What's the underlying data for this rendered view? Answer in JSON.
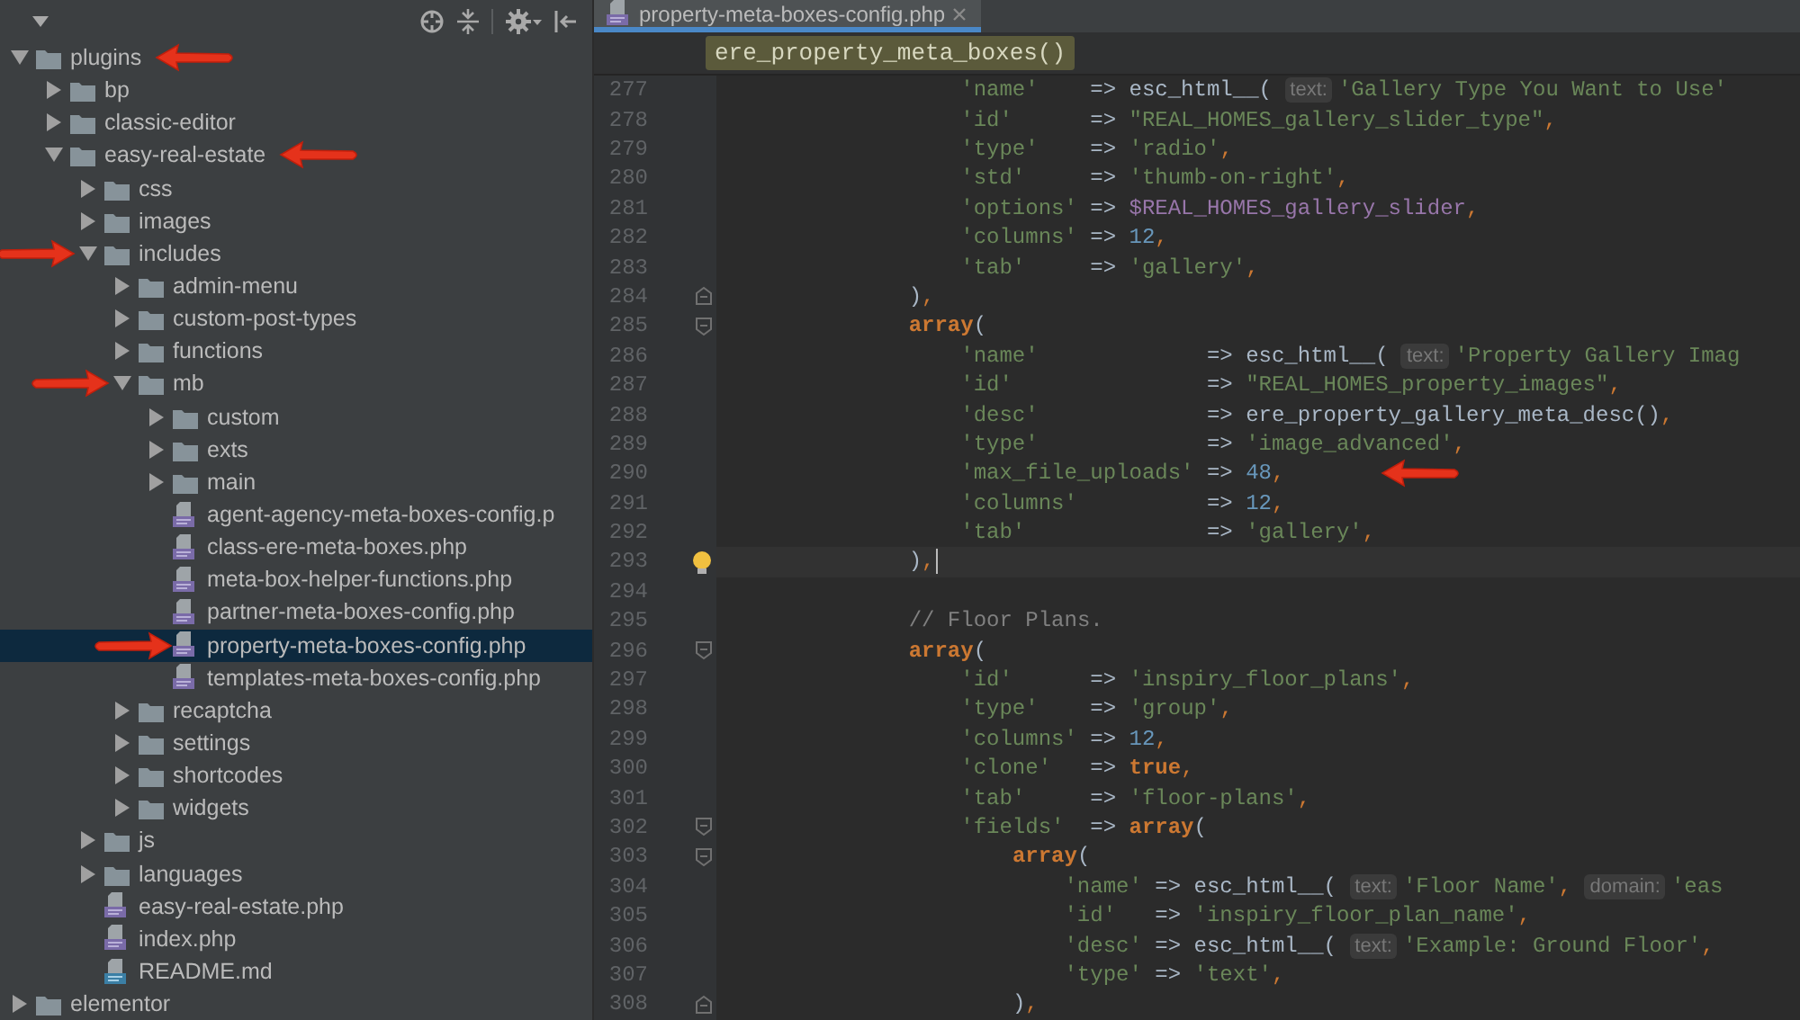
{
  "project_panel": {
    "tree": [
      {
        "name": "plugins",
        "kind": "folder",
        "expanded": true,
        "selected": false,
        "arrow_after": true,
        "children": [
          {
            "name": "bp",
            "kind": "folder",
            "expanded": false,
            "selected": false
          },
          {
            "name": "classic-editor",
            "kind": "folder",
            "expanded": false,
            "selected": false
          },
          {
            "name": "easy-real-estate",
            "kind": "folder",
            "expanded": true,
            "selected": false,
            "arrow_after": true,
            "children": [
              {
                "name": "css",
                "kind": "folder",
                "expanded": false,
                "selected": false
              },
              {
                "name": "images",
                "kind": "folder",
                "expanded": false,
                "selected": false
              },
              {
                "name": "includes",
                "kind": "folder",
                "expanded": true,
                "selected": false,
                "arrow_before": true,
                "children": [
                  {
                    "name": "admin-menu",
                    "kind": "folder",
                    "expanded": false,
                    "selected": false
                  },
                  {
                    "name": "custom-post-types",
                    "kind": "folder",
                    "expanded": false,
                    "selected": false
                  },
                  {
                    "name": "functions",
                    "kind": "folder",
                    "expanded": false,
                    "selected": false
                  },
                  {
                    "name": "mb",
                    "kind": "folder",
                    "expanded": true,
                    "selected": false,
                    "arrow_before": true,
                    "children": [
                      {
                        "name": "custom",
                        "kind": "folder",
                        "expanded": false,
                        "selected": false
                      },
                      {
                        "name": "exts",
                        "kind": "folder",
                        "expanded": false,
                        "selected": false
                      },
                      {
                        "name": "main",
                        "kind": "folder",
                        "expanded": false,
                        "selected": false
                      },
                      {
                        "name": "agent-agency-meta-boxes-config.p",
                        "kind": "php",
                        "selected": false
                      },
                      {
                        "name": "class-ere-meta-boxes.php",
                        "kind": "php",
                        "selected": false
                      },
                      {
                        "name": "meta-box-helper-functions.php",
                        "kind": "php",
                        "selected": false
                      },
                      {
                        "name": "partner-meta-boxes-config.php",
                        "kind": "php",
                        "selected": false
                      },
                      {
                        "name": "property-meta-boxes-config.php",
                        "kind": "php",
                        "selected": true,
                        "arrow_before": true
                      },
                      {
                        "name": "templates-meta-boxes-config.php",
                        "kind": "php",
                        "selected": false
                      }
                    ]
                  },
                  {
                    "name": "recaptcha",
                    "kind": "folder",
                    "expanded": false,
                    "selected": false
                  },
                  {
                    "name": "settings",
                    "kind": "folder",
                    "expanded": false,
                    "selected": false
                  },
                  {
                    "name": "shortcodes",
                    "kind": "folder",
                    "expanded": false,
                    "selected": false
                  },
                  {
                    "name": "widgets",
                    "kind": "folder",
                    "expanded": false,
                    "selected": false
                  }
                ]
              },
              {
                "name": "js",
                "kind": "folder",
                "expanded": false,
                "selected": false
              },
              {
                "name": "languages",
                "kind": "folder",
                "expanded": false,
                "selected": false
              },
              {
                "name": "easy-real-estate.php",
                "kind": "php",
                "selected": false
              },
              {
                "name": "index.php",
                "kind": "php",
                "selected": false
              },
              {
                "name": "README.md",
                "kind": "md",
                "selected": false
              }
            ]
          }
        ]
      },
      {
        "name": "elementor",
        "kind": "folder",
        "expanded": false,
        "selected": false
      }
    ]
  },
  "editor": {
    "tab": {
      "title": "property-meta-boxes-config.php",
      "selected": true
    },
    "breadcrumb": "ere_property_meta_boxes()",
    "lines": [
      {
        "number": "277",
        "segments": [
          {
            "kind": "str",
            "text": "                  'name'"
          },
          {
            "kind": "plain",
            "text": "    => esc_html__( "
          },
          {
            "kind": "hint",
            "text": "text:"
          },
          {
            "kind": "str",
            "text": "'Gallery Type You Want to Use'"
          }
        ]
      },
      {
        "number": "278",
        "segments": [
          {
            "kind": "str",
            "text": "                  'id'"
          },
          {
            "kind": "plain",
            "text": "      => "
          },
          {
            "kind": "str",
            "text": "\"REAL_HOMES_gallery_slider_type\""
          },
          {
            "kind": "punct",
            "text": ","
          }
        ]
      },
      {
        "number": "279",
        "segments": [
          {
            "kind": "str",
            "text": "                  'type'"
          },
          {
            "kind": "plain",
            "text": "    => "
          },
          {
            "kind": "str",
            "text": "'radio'"
          },
          {
            "kind": "punct",
            "text": ","
          }
        ]
      },
      {
        "number": "280",
        "segments": [
          {
            "kind": "str",
            "text": "                  'std'"
          },
          {
            "kind": "plain",
            "text": "     => "
          },
          {
            "kind": "str",
            "text": "'thumb-on-right'"
          },
          {
            "kind": "punct",
            "text": ","
          }
        ]
      },
      {
        "number": "281",
        "segments": [
          {
            "kind": "str",
            "text": "                  'options'"
          },
          {
            "kind": "plain",
            "text": " => "
          },
          {
            "kind": "var",
            "text": "$REAL_HOMES_gallery_slider"
          },
          {
            "kind": "punct",
            "text": ","
          }
        ]
      },
      {
        "number": "282",
        "segments": [
          {
            "kind": "str",
            "text": "                  'columns'"
          },
          {
            "kind": "plain",
            "text": " => "
          },
          {
            "kind": "num",
            "text": "12"
          },
          {
            "kind": "punct",
            "text": ","
          }
        ]
      },
      {
        "number": "283",
        "segments": [
          {
            "kind": "str",
            "text": "                  'tab'"
          },
          {
            "kind": "plain",
            "text": "     => "
          },
          {
            "kind": "str",
            "text": "'gallery'"
          },
          {
            "kind": "punct",
            "text": ","
          }
        ]
      },
      {
        "number": "284",
        "fold_end": true,
        "segments": [
          {
            "kind": "plain",
            "text": "              )"
          },
          {
            "kind": "punct",
            "text": ","
          }
        ]
      },
      {
        "number": "285",
        "fold_start": true,
        "segments": [
          {
            "kind": "kw",
            "text": "              array"
          },
          {
            "kind": "plain",
            "text": "("
          }
        ]
      },
      {
        "number": "286",
        "segments": [
          {
            "kind": "str",
            "text": "                  'name'"
          },
          {
            "kind": "plain",
            "text": "             => esc_html__( "
          },
          {
            "kind": "hint",
            "text": "text:"
          },
          {
            "kind": "str",
            "text": "'Property Gallery Imag"
          }
        ]
      },
      {
        "number": "287",
        "segments": [
          {
            "kind": "str",
            "text": "                  'id'"
          },
          {
            "kind": "plain",
            "text": "               => "
          },
          {
            "kind": "str",
            "text": "\"REAL_HOMES_property_images\""
          },
          {
            "kind": "punct",
            "text": ","
          }
        ]
      },
      {
        "number": "288",
        "segments": [
          {
            "kind": "str",
            "text": "                  'desc'"
          },
          {
            "kind": "plain",
            "text": "             => ere_property_gallery_meta_desc()"
          },
          {
            "kind": "punct",
            "text": ","
          }
        ]
      },
      {
        "number": "289",
        "segments": [
          {
            "kind": "str",
            "text": "                  'type'"
          },
          {
            "kind": "plain",
            "text": "             => "
          },
          {
            "kind": "str",
            "text": "'image_advanced'"
          },
          {
            "kind": "punct",
            "text": ","
          }
        ]
      },
      {
        "number": "290",
        "arrow_after": true,
        "segments": [
          {
            "kind": "str",
            "text": "                  'max_file_uploads'"
          },
          {
            "kind": "plain",
            "text": " => "
          },
          {
            "kind": "num",
            "text": "48"
          },
          {
            "kind": "punct",
            "text": ","
          }
        ]
      },
      {
        "number": "291",
        "segments": [
          {
            "kind": "str",
            "text": "                  'columns'"
          },
          {
            "kind": "plain",
            "text": "          => "
          },
          {
            "kind": "num",
            "text": "12"
          },
          {
            "kind": "punct",
            "text": ","
          }
        ]
      },
      {
        "number": "292",
        "segments": [
          {
            "kind": "str",
            "text": "                  'tab'"
          },
          {
            "kind": "plain",
            "text": "              => "
          },
          {
            "kind": "str",
            "text": "'gallery'"
          },
          {
            "kind": "punct",
            "text": ","
          }
        ]
      },
      {
        "number": "293",
        "fold_end": true,
        "current": true,
        "bulb": true,
        "segments": [
          {
            "kind": "plain",
            "text": "              )"
          },
          {
            "kind": "punct",
            "text": ","
          }
        ]
      },
      {
        "number": "294"
      },
      {
        "number": "295",
        "segments": [
          {
            "kind": "comment",
            "text": "              // Floor Plans."
          }
        ]
      },
      {
        "number": "296",
        "fold_start": true,
        "segments": [
          {
            "kind": "kw",
            "text": "              array"
          },
          {
            "kind": "plain",
            "text": "("
          }
        ]
      },
      {
        "number": "297",
        "segments": [
          {
            "kind": "str",
            "text": "                  'id'"
          },
          {
            "kind": "plain",
            "text": "      => "
          },
          {
            "kind": "str",
            "text": "'inspiry_floor_plans'"
          },
          {
            "kind": "punct",
            "text": ","
          }
        ]
      },
      {
        "number": "298",
        "segments": [
          {
            "kind": "str",
            "text": "                  'type'"
          },
          {
            "kind": "plain",
            "text": "    => "
          },
          {
            "kind": "str",
            "text": "'group'"
          },
          {
            "kind": "punct",
            "text": ","
          }
        ]
      },
      {
        "number": "299",
        "segments": [
          {
            "kind": "str",
            "text": "                  'columns'"
          },
          {
            "kind": "plain",
            "text": " => "
          },
          {
            "kind": "num",
            "text": "12"
          },
          {
            "kind": "punct",
            "text": ","
          }
        ]
      },
      {
        "number": "300",
        "segments": [
          {
            "kind": "str",
            "text": "                  'clone'"
          },
          {
            "kind": "plain",
            "text": "   => "
          },
          {
            "kind": "kw",
            "text": "true"
          },
          {
            "kind": "punct",
            "text": ","
          }
        ]
      },
      {
        "number": "301",
        "segments": [
          {
            "kind": "str",
            "text": "                  'tab'"
          },
          {
            "kind": "plain",
            "text": "     => "
          },
          {
            "kind": "str",
            "text": "'floor-plans'"
          },
          {
            "kind": "punct",
            "text": ","
          }
        ]
      },
      {
        "number": "302",
        "fold_start": true,
        "segments": [
          {
            "kind": "str",
            "text": "                  'fields'"
          },
          {
            "kind": "plain",
            "text": "  => "
          },
          {
            "kind": "kw",
            "text": "array"
          },
          {
            "kind": "plain",
            "text": "("
          }
        ]
      },
      {
        "number": "303",
        "fold_start": true,
        "segments": [
          {
            "kind": "kw",
            "text": "                      array"
          },
          {
            "kind": "plain",
            "text": "("
          }
        ]
      },
      {
        "number": "304",
        "segments": [
          {
            "kind": "str",
            "text": "                          'name'"
          },
          {
            "kind": "plain",
            "text": " => esc_html__( "
          },
          {
            "kind": "hint",
            "text": "text:"
          },
          {
            "kind": "str",
            "text": "'Floor Name'"
          },
          {
            "kind": "punct",
            "text": ", "
          },
          {
            "kind": "hint",
            "text": "domain:"
          },
          {
            "kind": "str",
            "text": "'eas"
          }
        ]
      },
      {
        "number": "305",
        "segments": [
          {
            "kind": "str",
            "text": "                          'id'"
          },
          {
            "kind": "plain",
            "text": "   => "
          },
          {
            "kind": "str",
            "text": "'inspiry_floor_plan_name'"
          },
          {
            "kind": "punct",
            "text": ","
          }
        ]
      },
      {
        "number": "306",
        "segments": [
          {
            "kind": "str",
            "text": "                          'desc'"
          },
          {
            "kind": "plain",
            "text": " => esc_html__( "
          },
          {
            "kind": "hint",
            "text": "text:"
          },
          {
            "kind": "str",
            "text": "'Example: Ground Floor'"
          },
          {
            "kind": "punct",
            "text": ","
          }
        ]
      },
      {
        "number": "307",
        "segments": [
          {
            "kind": "str",
            "text": "                          'type'"
          },
          {
            "kind": "plain",
            "text": " => "
          },
          {
            "kind": "str",
            "text": "'text'"
          },
          {
            "kind": "punct",
            "text": ","
          }
        ]
      },
      {
        "number": "308",
        "fold_end": true,
        "segments": [
          {
            "kind": "plain",
            "text": "                      )"
          },
          {
            "kind": "punct",
            "text": ","
          }
        ]
      }
    ]
  }
}
